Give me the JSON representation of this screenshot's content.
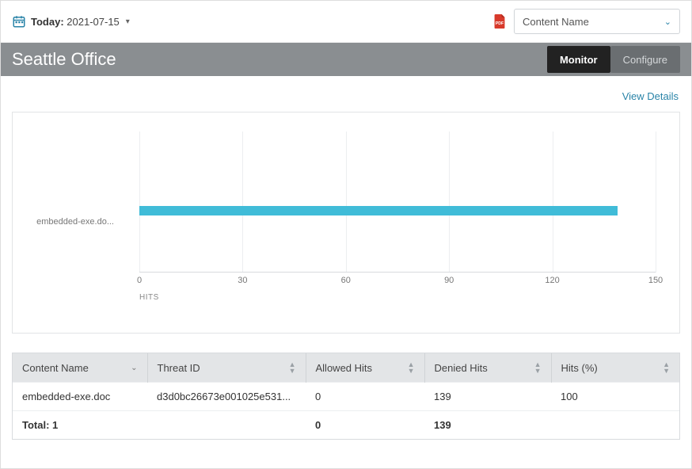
{
  "header": {
    "date_label": "Today:",
    "date_value": "2021-07-15",
    "pdf_color": "#d83a2b",
    "selector_value": "Content Name"
  },
  "titlebar": {
    "title": "Seattle Office",
    "tabs": {
      "monitor": "Monitor",
      "configure": "Configure"
    }
  },
  "links": {
    "view_details": "View Details"
  },
  "chart_data": {
    "type": "bar",
    "orientation": "horizontal",
    "categories": [
      "embedded-exe.do..."
    ],
    "values": [
      139
    ],
    "xticks": [
      0,
      30,
      60,
      90,
      120,
      150
    ],
    "xlim": [
      0,
      150
    ],
    "xlabel": "HITS",
    "bar_color": "#40bcd8"
  },
  "table": {
    "columns": {
      "content_name": "Content Name",
      "threat_id": "Threat ID",
      "allowed_hits": "Allowed Hits",
      "denied_hits": "Denied Hits",
      "hits_pct": "Hits (%)"
    },
    "rows": [
      {
        "content_name": "embedded-exe.doc",
        "threat_id": "d3d0bc26673e001025e531...",
        "allowed_hits": "0",
        "denied_hits": "139",
        "hits_pct": "100"
      }
    ],
    "total": {
      "label": "Total: 1",
      "allowed_hits": "0",
      "denied_hits": "139"
    }
  }
}
